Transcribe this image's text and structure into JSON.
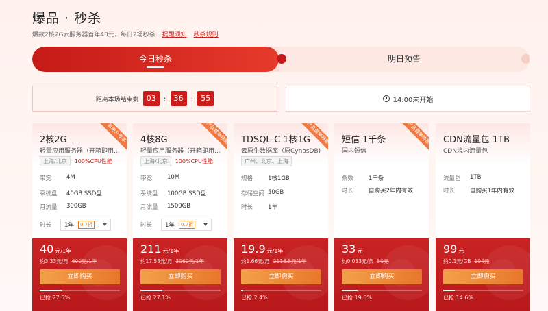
{
  "header": {
    "title": "爆品 · 秒杀",
    "subtitle": "爆款2核2G云服务器首年40元，每日2场秒杀",
    "link_notice": "提醒须知",
    "link_rules": "秒杀规则"
  },
  "tabs": {
    "today": "今日秒杀",
    "tomorrow": "明日预告"
  },
  "countdown": {
    "label": "距离本场结束剩",
    "h": "03",
    "m": "36",
    "s": "55",
    "sep": ":"
  },
  "next": {
    "label": "14:00未开始"
  },
  "cards": [
    {
      "name": "2核2G",
      "desc": "轻量应用服务器（开箱即用...",
      "tag": "上海/北京",
      "tag_hl": "100%CPU性能",
      "ribbon": "新用户专享",
      "specs": [
        {
          "k": "带宽",
          "v": "4M"
        },
        {
          "k": "系统盘",
          "v": "40GB SSD盘"
        },
        {
          "k": "月流量",
          "v": "300GB"
        }
      ],
      "duration_label": "时长",
      "duration": "1年",
      "discount": "0.7折",
      "price": "40",
      "price_unit": "元/1年",
      "per": "约3.33元/月",
      "orig": "600元/1年",
      "buy": "立即购买",
      "sold_pct": 27.5,
      "sold": "已抢 27.5%"
    },
    {
      "name": "4核8G",
      "desc": "轻量应用服务器（开箱即用...",
      "tag": "上海/北京",
      "tag_hl": "100%CPU性能",
      "ribbon": "产品首单特惠",
      "specs": [
        {
          "k": "带宽",
          "v": "10M"
        },
        {
          "k": "系统盘",
          "v": "100GB SSD盘"
        },
        {
          "k": "月流量",
          "v": "1500GB"
        }
      ],
      "duration_label": "时长",
      "duration": "1年",
      "discount": "0.7折",
      "price": "211",
      "price_unit": "元/1年",
      "per": "约17.58元/月",
      "orig": "3060元/1年",
      "buy": "立即购买",
      "sold_pct": 27.1,
      "sold": "已抢 27.1%"
    },
    {
      "name": "TDSQL-C 1核1G",
      "desc": "云原生数据库（原CynosDB)",
      "tag": "广州、北京、上海",
      "tag_hl": "",
      "ribbon": "产品首单特惠",
      "specs": [
        {
          "k": "规格",
          "v": "1核1GB"
        },
        {
          "k": "存储空间",
          "v": "50GB"
        },
        {
          "k": "时长",
          "v": "1年"
        }
      ],
      "duration_label": "",
      "duration": "",
      "discount": "",
      "price": "19.9",
      "price_unit": "元/1年",
      "per": "约1.66元/月",
      "orig": "2116.8元/1年",
      "buy": "立即购买",
      "sold_pct": 2.4,
      "sold": "已抢 2.4%"
    },
    {
      "name": "短信 1千条",
      "desc": "国内短信",
      "tag": "",
      "tag_hl": "",
      "ribbon": "产品首单特惠",
      "specs": [
        {
          "k": "条数",
          "v": "1千条"
        },
        {
          "k": "时长",
          "v": "自购买2年内有效"
        }
      ],
      "duration_label": "",
      "duration": "",
      "discount": "",
      "price": "33",
      "price_unit": "元",
      "per": "约0.033元/条",
      "orig": "50元",
      "buy": "立即购买",
      "sold_pct": 19.6,
      "sold": "已抢 19.6%"
    },
    {
      "name": "CDN流量包 1TB",
      "desc": "CDN境内流量包",
      "tag": "",
      "tag_hl": "",
      "ribbon": "",
      "specs": [
        {
          "k": "流量包",
          "v": "1TB"
        },
        {
          "k": "时长",
          "v": "自购买1年内有效"
        }
      ],
      "duration_label": "",
      "duration": "",
      "discount": "",
      "price": "99",
      "price_unit": "元",
      "per": "约0.1元/GB",
      "orig": "194元",
      "buy": "立即购买",
      "sold_pct": 14.6,
      "sold": "已抢 14.6%"
    }
  ]
}
